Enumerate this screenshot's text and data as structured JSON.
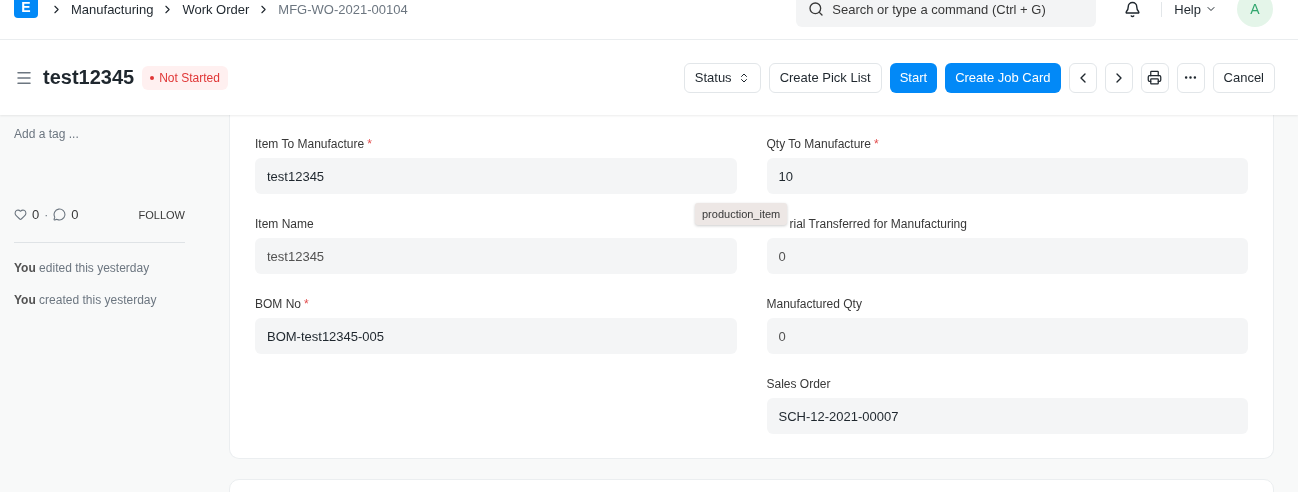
{
  "navbar": {
    "logo": "E",
    "breadcrumbs": [
      {
        "label": "Manufacturing",
        "current": false
      },
      {
        "label": "Work Order",
        "current": false
      },
      {
        "label": "MFG-WO-2021-00104",
        "current": true
      }
    ],
    "search": {
      "placeholder": "Search or type a command (Ctrl + G)"
    },
    "help": "Help",
    "avatar": "A"
  },
  "page_header": {
    "title": "test12345",
    "status": "Not Started",
    "buttons": [
      {
        "kind": "select",
        "label": "Status"
      },
      {
        "kind": "default",
        "label": "Create Pick List"
      },
      {
        "kind": "primary",
        "label": "Start"
      },
      {
        "kind": "primary",
        "label": "Create Job Card"
      },
      {
        "kind": "prev"
      },
      {
        "kind": "next"
      },
      {
        "kind": "print"
      },
      {
        "kind": "more"
      },
      {
        "kind": "default",
        "label": "Cancel"
      }
    ]
  },
  "sidebar": {
    "tag_placeholder": "Add a tag ...",
    "likes": "0",
    "separator": "·",
    "comments": "0",
    "follow": "FOLLOW",
    "activity": [
      "**You** edited this yesterday",
      "**You** created this yesterday"
    ]
  },
  "form": {
    "left": [
      {
        "label": "Item To Manufacture",
        "required_mark": "*",
        "value": "test12345",
        "read_only": false
      },
      {
        "label": "Item Name",
        "value": "test12345",
        "read_only": true
      },
      {
        "label": "BOM No",
        "required_mark": "*",
        "value": "BOM-test12345-005",
        "read_only": false
      }
    ],
    "right": [
      {
        "label": "Qty To Manufacture",
        "required_mark": "*",
        "value": "10",
        "read_only": false
      },
      {
        "label": "rial Transferred for Manufacturing",
        "value": "0",
        "read_only": true,
        "covered": true
      },
      {
        "label": "Manufactured Qty",
        "value": "0",
        "read_only": true
      },
      {
        "label": "Sales Order",
        "value": "SCH-12-2021-00007",
        "read_only": false
      }
    ],
    "tooltip": "production_item"
  }
}
